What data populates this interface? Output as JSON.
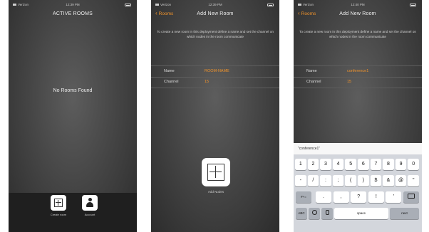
{
  "screen1": {
    "status": {
      "carrier": "Verizon",
      "time": "12:39 PM"
    },
    "title": "ACTIVE ROOMS",
    "empty_message": "No Rooms Found",
    "tabs": [
      {
        "label": "Create room",
        "icon": "plus-square-icon"
      },
      {
        "label": "Account",
        "icon": "person-icon"
      }
    ]
  },
  "screen2": {
    "status": {
      "carrier": "Verizon",
      "time": "12:39 PM"
    },
    "back_label": "Rooms",
    "title": "Add New Room",
    "intro": "To create a new room in this deployment define a name and set the channel on which nodes in the room communicate",
    "fields": [
      {
        "label": "Name",
        "value": "ROOM-NAME"
      },
      {
        "label": "Channel",
        "value": "15"
      }
    ],
    "add_nodes_label": "Add Nodes"
  },
  "screen3": {
    "status": {
      "carrier": "Verizon",
      "time": "12:40 PM"
    },
    "back_label": "Rooms",
    "title": "Add New Room",
    "intro": "To create a new room in this deployment define a name and set the channel on which nodes in the room communicate",
    "fields": [
      {
        "label": "Name",
        "value": "conference1"
      },
      {
        "label": "Channel",
        "value": "15"
      }
    ],
    "keyboard": {
      "suggestion": "\"conference1\"",
      "row1": [
        "1",
        "2",
        "3",
        "4",
        "5",
        "6",
        "7",
        "8",
        "9",
        "0"
      ],
      "row2": [
        "-",
        "/",
        ":",
        ";",
        "(",
        ")",
        "$",
        "&",
        "@",
        "\""
      ],
      "row3_left": "#+=",
      "row3": [
        ".",
        ",",
        "?",
        "!",
        "'"
      ],
      "row4_left": "ABC",
      "space": "space",
      "next": "next"
    }
  },
  "colors": {
    "accent": "#f0932b",
    "tabbar": "#1f1f1f",
    "keyboard": "#d3d6dc"
  }
}
